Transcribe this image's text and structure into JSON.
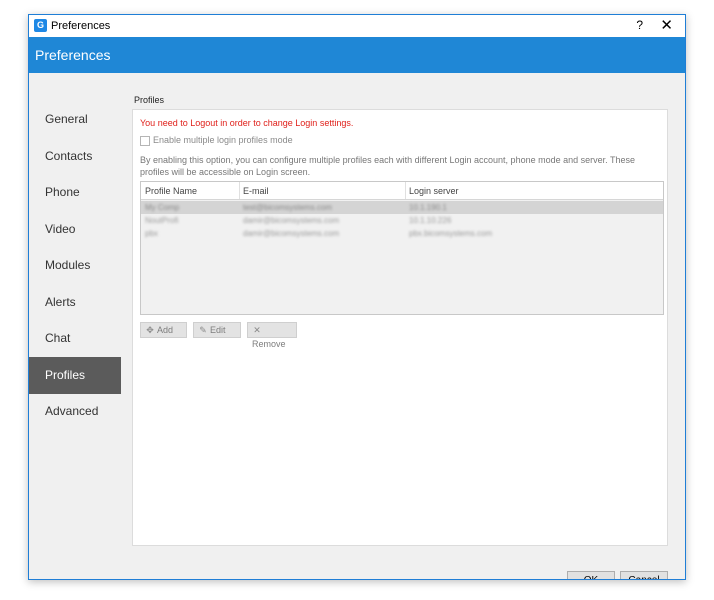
{
  "window": {
    "title": "Preferences",
    "help_label": "?",
    "close_label": "✕",
    "app_icon": "G"
  },
  "header": {
    "title": "Preferences"
  },
  "sidebar": {
    "items": [
      {
        "label": "General"
      },
      {
        "label": "Contacts"
      },
      {
        "label": "Phone"
      },
      {
        "label": "Video"
      },
      {
        "label": "Modules"
      },
      {
        "label": "Alerts"
      },
      {
        "label": "Chat"
      },
      {
        "label": "Profiles",
        "active": true
      },
      {
        "label": "Advanced"
      }
    ]
  },
  "profiles": {
    "section_title": "Profiles",
    "warning": "You need to Logout in order to change Login settings.",
    "checkbox_label": "Enable multiple login profiles mode",
    "checkbox_checked": false,
    "description": "By enabling this option, you can configure multiple profiles each with different Login account, phone mode and server. These profiles will be accessible on Login screen.",
    "table": {
      "columns": [
        "Profile Name",
        "E-mail",
        "Login server"
      ],
      "rows": [
        {
          "name": "My Comp",
          "email": "test@bicomsystems.com",
          "server": "10.1.190.1",
          "selected": true
        },
        {
          "name": "NoutProfi",
          "email": "damir@bicomsystems.com",
          "server": "10.1.10.226",
          "selected": false
        },
        {
          "name": "pbx",
          "email": "damir@bicomsystems.com",
          "server": "pbx.bicomsystems.com",
          "selected": false
        }
      ]
    },
    "buttons": {
      "add": "Add",
      "edit": "Edit",
      "remove": "Remove"
    }
  },
  "footer": {
    "ok": "OK",
    "cancel": "Cancel"
  },
  "colors": {
    "accent": "#1f87d6",
    "warning": "#e0211b",
    "active_nav": "#5b5b5b"
  },
  "icons": {
    "add": "plus-icon",
    "edit": "pencil-icon",
    "remove": "x-icon"
  }
}
